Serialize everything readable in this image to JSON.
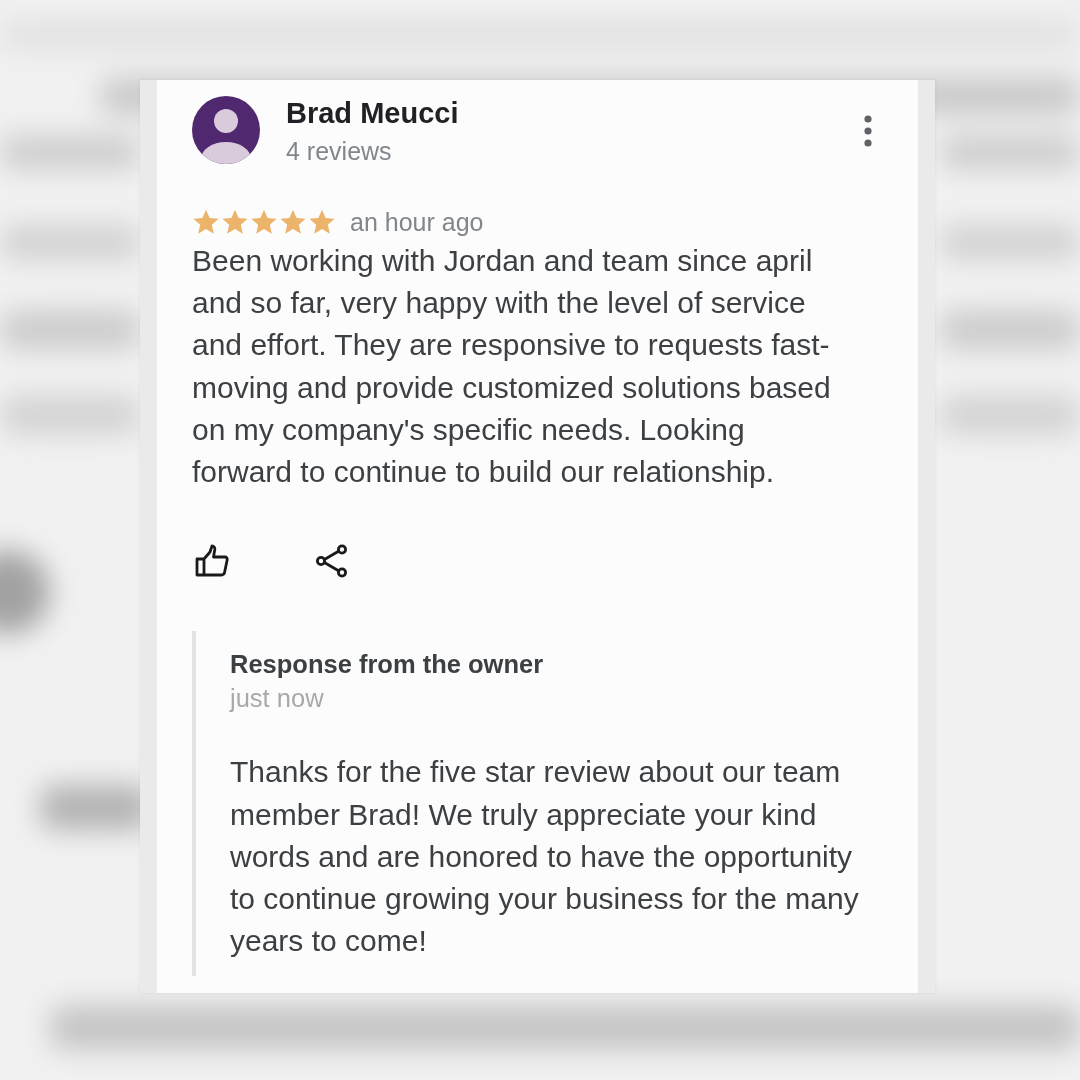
{
  "reviewer": {
    "name": "Brad Meucci",
    "review_count": "4 reviews"
  },
  "review": {
    "stars": 5,
    "time": "an hour ago",
    "text": "Been working with Jordan and team since april and so far, very happy with the level of service and effort. They are responsive to requests fast-moving and provide customized solutions based on my company's specific needs. Looking forward to continue to build our relationship."
  },
  "owner_response": {
    "title": "Response from the owner",
    "time": "just now",
    "text": "Thanks for the five star review about our team member Brad! We truly appreciate your kind words and are honored to have the opportunity to continue growing your business for the many years to come!"
  }
}
